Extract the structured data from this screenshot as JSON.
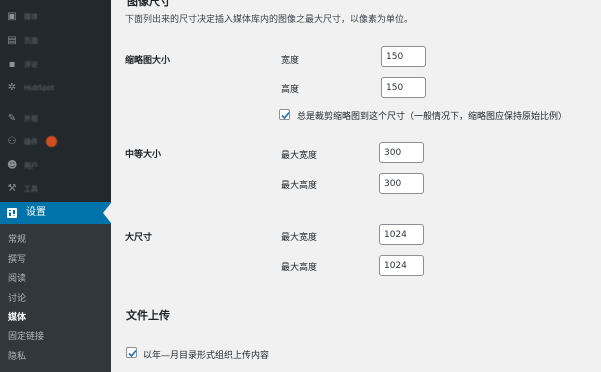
{
  "sidebar": {
    "items": [
      {
        "label": "媒体",
        "icon": "media-icon"
      },
      {
        "label": "页面",
        "icon": "pages-icon"
      },
      {
        "label": "评论",
        "icon": "comments-icon"
      },
      {
        "label": "HubSpot",
        "icon": "hubspot-icon"
      },
      {
        "label": "外观",
        "icon": "appearance-icon"
      },
      {
        "label": "插件",
        "icon": "plugins-icon"
      },
      {
        "label": "用户",
        "icon": "users-icon"
      },
      {
        "label": "工具",
        "icon": "tools-icon"
      }
    ],
    "active_item": {
      "label": "设置",
      "icon": "settings-icon"
    },
    "submenu": [
      "常规",
      "撰写",
      "阅读",
      "讨论",
      "媒体",
      "固定链接",
      "隐私"
    ],
    "current_submenu": "媒体",
    "colors": {
      "sidebar_bg": "#23282d",
      "active_bg": "#0073aa",
      "submenu_bg": "#32373c",
      "badge": "#d54e21"
    }
  },
  "main": {
    "section_title": "图像尺寸",
    "description": "下面列出来的尺寸决定插入媒体库内的图像之最大尺寸，以像素为单位。",
    "thumbnail": {
      "label": "缩略图大小",
      "width_label": "宽度",
      "width_value": "150",
      "height_label": "高度",
      "height_value": "150",
      "crop_label": "总是裁剪缩略图到这个尺寸（一般情况下，缩略图应保持原始比例）",
      "crop_checked": true
    },
    "medium": {
      "label": "中等大小",
      "max_width_label": "最大宽度",
      "max_width_value": "300",
      "max_height_label": "最大高度",
      "max_height_value": "300"
    },
    "large": {
      "label": "大尺寸",
      "max_width_label": "最大宽度",
      "max_width_value": "1024",
      "max_height_label": "最大高度",
      "max_height_value": "1024"
    },
    "uploads": {
      "section_title": "文件上传",
      "organize_label": "以年—月目录形式组织上传内容",
      "organize_checked": true
    },
    "accent_color": "#2271b1"
  }
}
